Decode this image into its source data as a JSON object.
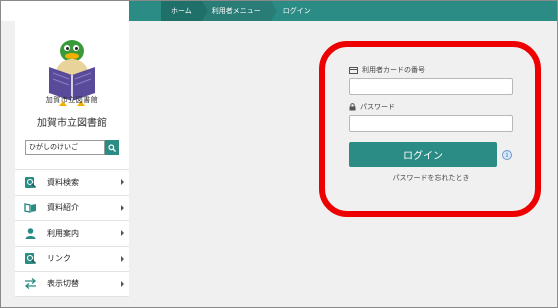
{
  "breadcrumb": {
    "items": [
      "ホーム",
      "利用者メニュー",
      "ログイン"
    ]
  },
  "sidebar": {
    "logo_caption": "加賀市立図書館",
    "library_name": "加賀市立図書館",
    "search": {
      "value": "ひがしのけいご"
    },
    "items": [
      {
        "label": "資料検索",
        "icon": "book-search-icon"
      },
      {
        "label": "資料紹介",
        "icon": "open-book-icon"
      },
      {
        "label": "利用案内",
        "icon": "user-guide-icon"
      },
      {
        "label": "リンク",
        "icon": "link-icon"
      },
      {
        "label": "表示切替",
        "icon": "switch-arrows-icon"
      }
    ]
  },
  "login": {
    "card_label": "利用者カードの番号",
    "password_label": "パスワード",
    "login_button": "ログイン",
    "forgot_link": "パスワードを忘れたとき"
  },
  "colors": {
    "accent": "#2a8c84",
    "highlight_ring": "#ee0000"
  }
}
